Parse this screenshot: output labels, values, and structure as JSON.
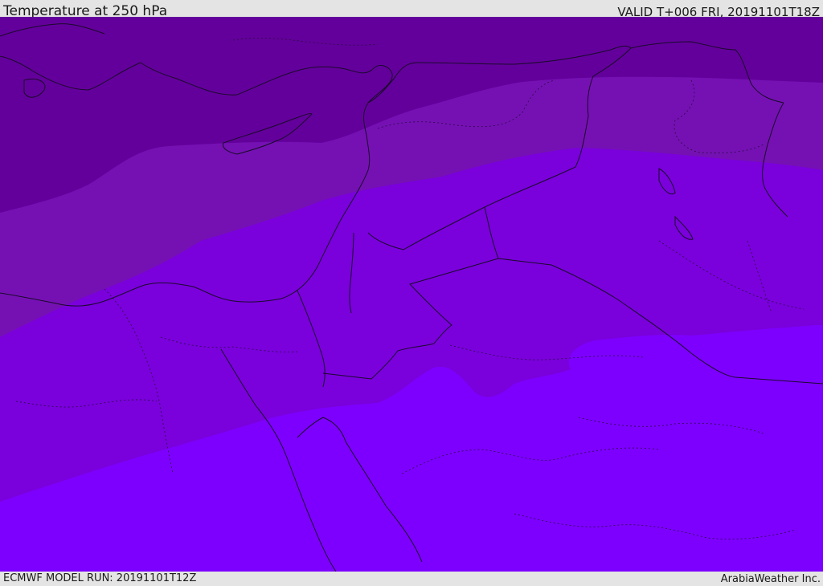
{
  "header": {
    "title": "Temperature at 250 hPa",
    "valid": "VALID T+006 FRI, 20191101T18Z"
  },
  "footer": {
    "model_run": "ECMWF MODEL RUN: 20191101T12Z",
    "credit": "ArabiaWeather Inc."
  },
  "map": {
    "field": "temperature",
    "level_hpa": 250,
    "band_colors": [
      "#63009b",
      "#7511b3",
      "#7a00dc",
      "#7d00ff"
    ],
    "coastline_color": "#1a0a2a",
    "border_style": "dotted"
  }
}
